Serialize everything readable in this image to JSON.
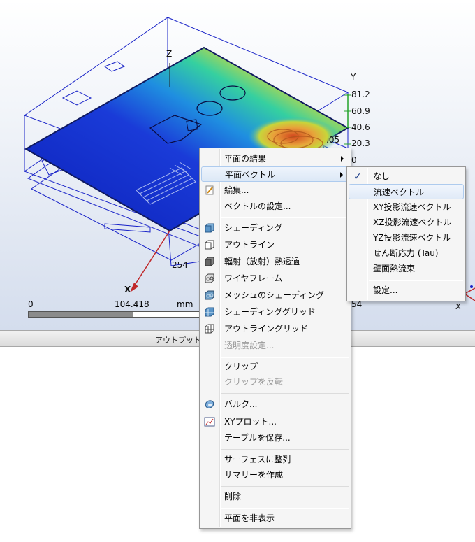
{
  "viewport": {
    "axes": {
      "z": "Z",
      "y": "Y",
      "x": "X"
    },
    "legend_values": [
      "81.2",
      "60.9",
      "40.6",
      "20.3",
      "0"
    ],
    "dimension_labels": [
      "254",
      ".05",
      "54"
    ],
    "scale": {
      "start": "0",
      "mid": "104.418",
      "unit": "mm",
      "fill_fraction": 0.6
    }
  },
  "output_bar": {
    "title": "アウトプットバ"
  },
  "main_menu": {
    "items": [
      {
        "label": "平面の結果",
        "submenu": true
      },
      {
        "label": "平面ベクトル",
        "submenu": true,
        "highlighted": true
      },
      {
        "label": "編集...",
        "icon": "edit-icon"
      },
      {
        "label": "ベクトルの設定..."
      },
      {
        "label": "シェーディング",
        "icon": "shaded-cube-icon"
      },
      {
        "label": "アウトライン",
        "icon": "outline-cube-icon"
      },
      {
        "label": "輻射（放射）熱透過",
        "icon": "radiation-cube-icon"
      },
      {
        "label": "ワイヤフレーム",
        "icon": "wireframe-cube-icon"
      },
      {
        "label": "メッシュのシェーディング",
        "icon": "mesh-shading-icon"
      },
      {
        "label": "シェーディンググリッド",
        "icon": "shading-grid-icon"
      },
      {
        "label": "アウトライングリッド",
        "icon": "outline-grid-icon"
      },
      {
        "label": "透明度設定...",
        "disabled": true
      },
      {
        "label": "クリップ"
      },
      {
        "label": "クリップを反転",
        "disabled": true
      },
      {
        "label": "バルク...",
        "icon": "bulk-icon"
      },
      {
        "label": "XYプロット...",
        "icon": "xy-plot-icon"
      },
      {
        "label": "テーブルを保存..."
      },
      {
        "label": "サーフェスに整列"
      },
      {
        "label": "サマリーを作成"
      },
      {
        "label": "削除"
      },
      {
        "label": "平面を非表示"
      }
    ]
  },
  "sub_menu": {
    "items": [
      {
        "label": "なし",
        "checked": true
      },
      {
        "label": "流速ベクトル",
        "highlighted": true
      },
      {
        "label": "XY投影流速ベクトル"
      },
      {
        "label": "XZ投影流速ベクトル"
      },
      {
        "label": "YZ投影流速ベクトル"
      },
      {
        "label": "せん断応力 (Tau)"
      },
      {
        "label": "壁面熱流束"
      },
      {
        "label": "設定..."
      }
    ]
  }
}
